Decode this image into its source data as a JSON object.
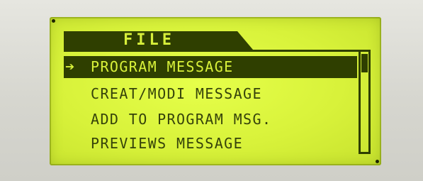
{
  "screen": {
    "title": "FILE",
    "selection_marker": "➔",
    "menu": [
      {
        "label": "PROGRAM MESSAGE",
        "selected": true
      },
      {
        "label": "CREAT/MODI MESSAGE",
        "selected": false
      },
      {
        "label": "ADD TO PROGRAM MSG.",
        "selected": false
      },
      {
        "label": "PREVIEWS MESSAGE",
        "selected": false
      }
    ]
  },
  "colors": {
    "lcd_background": "#d8f23a",
    "lcd_foreground": "#2f3f00",
    "bezel": "#d9d9d3"
  }
}
